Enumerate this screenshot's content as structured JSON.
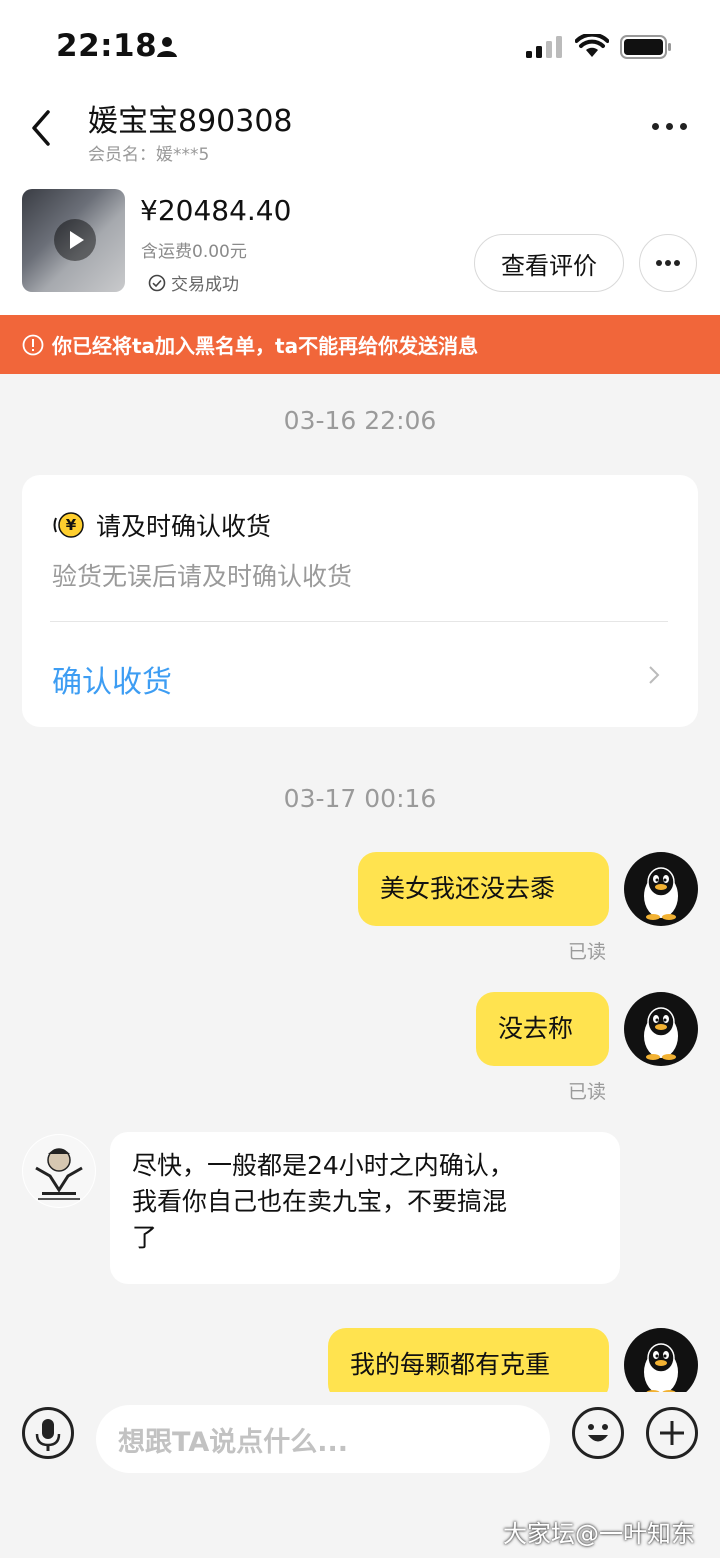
{
  "status_bar": {
    "time": "22:18",
    "icons": [
      "person-icon",
      "signal-icon",
      "wifi-icon",
      "battery-icon"
    ]
  },
  "header": {
    "name": "媛宝宝890308",
    "member_label": "会员名：媛***5"
  },
  "product": {
    "price": "¥20484.40",
    "shipping": "含运费0.00元",
    "status": "交易成功",
    "review_button": "查看评价"
  },
  "banner": {
    "text": "你已经将ta加入黑名单，ta不能再给你发送消息",
    "color": "#f1663a"
  },
  "timestamps": [
    "03-16 22:06",
    "03-17 00:16"
  ],
  "confirm_card": {
    "title": "请及时确认收货",
    "subtitle": "验货无误后请及时确认收货",
    "action": "确认收货",
    "action_color": "#3d9df3"
  },
  "messages": [
    {
      "from": "me",
      "text": "美女我还没去黍",
      "read": "已读"
    },
    {
      "from": "me",
      "text": "没去称",
      "read": "已读"
    },
    {
      "from": "them",
      "lines": [
        "尽快，一般都是24小时之内确认，",
        "我看你自己也在卖九宝，不要搞混",
        "了"
      ]
    },
    {
      "from": "me",
      "text": "我的每颗都有克重"
    }
  ],
  "input": {
    "placeholder": "想跟TA说点什么..."
  },
  "watermark": "大家坛@一叶知东",
  "colors": {
    "my_bubble": "#ffe34f",
    "background": "#f4f4f4"
  }
}
